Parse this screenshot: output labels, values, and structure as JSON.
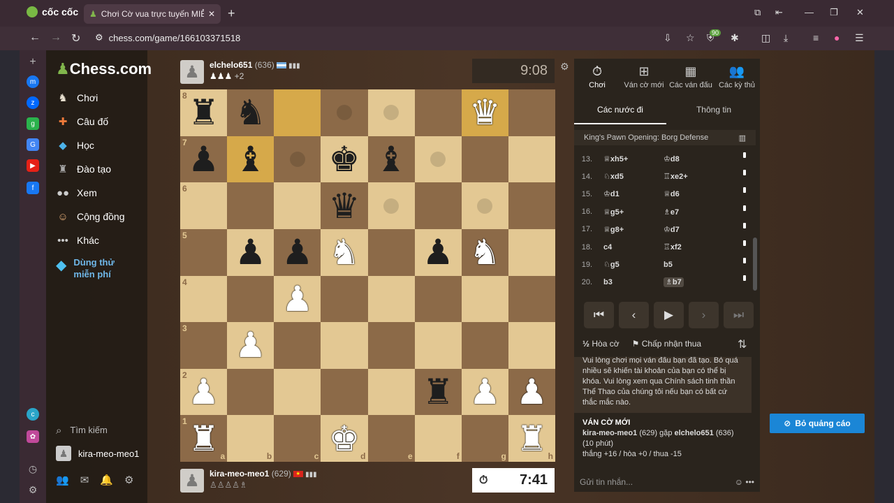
{
  "browser": {
    "brand": "cốc cốc",
    "tab_title": "Chơi Cờ vua trực tuyến MIỄ",
    "url": "chess.com/game/166103371518",
    "ext_badge": "90"
  },
  "sidebar": {
    "logo": "Chess.com",
    "items": [
      {
        "label": "Chơi",
        "icon": "pawn-hand-icon"
      },
      {
        "label": "Câu đố",
        "icon": "puzzle-icon"
      },
      {
        "label": "Học",
        "icon": "graduation-cap-icon"
      },
      {
        "label": "Đào tạo",
        "icon": "training-icon"
      },
      {
        "label": "Xem",
        "icon": "binoculars-icon"
      },
      {
        "label": "Cộng đồng",
        "icon": "community-icon"
      },
      {
        "label": "Khác",
        "icon": "more-dots-icon"
      }
    ],
    "trial": "Dùng thử miễn phí",
    "search": "Tìm kiếm",
    "username": "kira-meo-meo1"
  },
  "top_player": {
    "name": "elchelo651",
    "rating": "(636)",
    "captured": "♟♟♟",
    "captured_extra": "+2",
    "clock": "9:08"
  },
  "bottom_player": {
    "name": "kira-meo-meo1",
    "rating": "(629)",
    "captured": "♙♙♙♙♗",
    "clock": "7:41"
  },
  "board": {
    "ranks": [
      "8",
      "7",
      "6",
      "5",
      "4",
      "3",
      "2",
      "1"
    ],
    "files": [
      "a",
      "b",
      "c",
      "d",
      "e",
      "f",
      "g",
      "h"
    ],
    "position": [
      [
        "bR",
        "bN",
        "",
        "",
        "",
        "",
        "wQ",
        ""
      ],
      [
        "bP",
        "bB",
        "",
        "bK",
        "bB",
        "",
        "",
        ""
      ],
      [
        "",
        "",
        "",
        "bQ",
        "",
        "",
        "",
        ""
      ],
      [
        "",
        "bP",
        "bP",
        "wN",
        "",
        "bP",
        "wN",
        ""
      ],
      [
        "",
        "",
        "wP",
        "",
        "",
        "",
        "",
        ""
      ],
      [
        "",
        "wP",
        "",
        "",
        "",
        "",
        "",
        ""
      ],
      [
        "wP",
        "",
        "",
        "",
        "",
        "bR",
        "wP",
        "wP"
      ],
      [
        "wR",
        "",
        "",
        "wK",
        "",
        "",
        "",
        "wR"
      ]
    ],
    "highlights": [
      "c8",
      "g8",
      "b7"
    ],
    "move_dots": [
      "d8",
      "f7",
      "c7",
      "d6",
      "g6",
      "e6",
      "e8"
    ]
  },
  "right_panel": {
    "tabs": [
      {
        "label": "Chơi",
        "icon": "stopwatch-icon"
      },
      {
        "label": "Ván cờ mới",
        "icon": "plus-board-icon"
      },
      {
        "label": "Các ván đấu",
        "icon": "checkerboard-icon"
      },
      {
        "label": "Các kỳ thủ",
        "icon": "players-icon"
      }
    ],
    "subtabs": [
      "Các nước đi",
      "Thông tin"
    ],
    "opening": "King's Pawn Opening: Borg Defense",
    "moves": [
      {
        "n": "13.",
        "w": "♕xh5+",
        "b": "♔d8"
      },
      {
        "n": "14.",
        "w": "♘xd5",
        "b": "♖xe2+"
      },
      {
        "n": "15.",
        "w": "♔d1",
        "b": "♕d6"
      },
      {
        "n": "16.",
        "w": "♕g5+",
        "b": "♗e7"
      },
      {
        "n": "17.",
        "w": "♕g8+",
        "b": "♔d7"
      },
      {
        "n": "18.",
        "w": "c4",
        "b": "♖xf2"
      },
      {
        "n": "19.",
        "w": "♘g5",
        "b": "b5"
      },
      {
        "n": "20.",
        "w": "b3",
        "b": "♗b7"
      }
    ],
    "controls": [
      "⏮",
      "‹",
      "▶",
      "›",
      "⏭"
    ],
    "draw_label": "Hòa cờ",
    "resign_label": "Chấp nhận thua",
    "notice": "Vui lòng chơi mọi ván đấu bạn đã tạo. Bỏ quá nhiều sẽ khiến tài khoản của bạn có thể bị khóa. Vui lòng xem qua Chính sách tinh thần Thể Thao của chúng tôi nếu bạn có bất cứ thắc mắc nào.",
    "newgame": {
      "header": "VÁN CỜ MỚI",
      "p1": "kira-meo-meo1",
      "p1r": "(629)",
      "vs": "gặp",
      "p2": "elchelo651",
      "p2r": "(636)",
      "tc": "(10 phút)",
      "stats": "thắng +16 / hòa +0 / thua -15"
    },
    "msg_placeholder": "Gửi tin nhắn..."
  },
  "ad_button": "Bỏ quảng cáo"
}
